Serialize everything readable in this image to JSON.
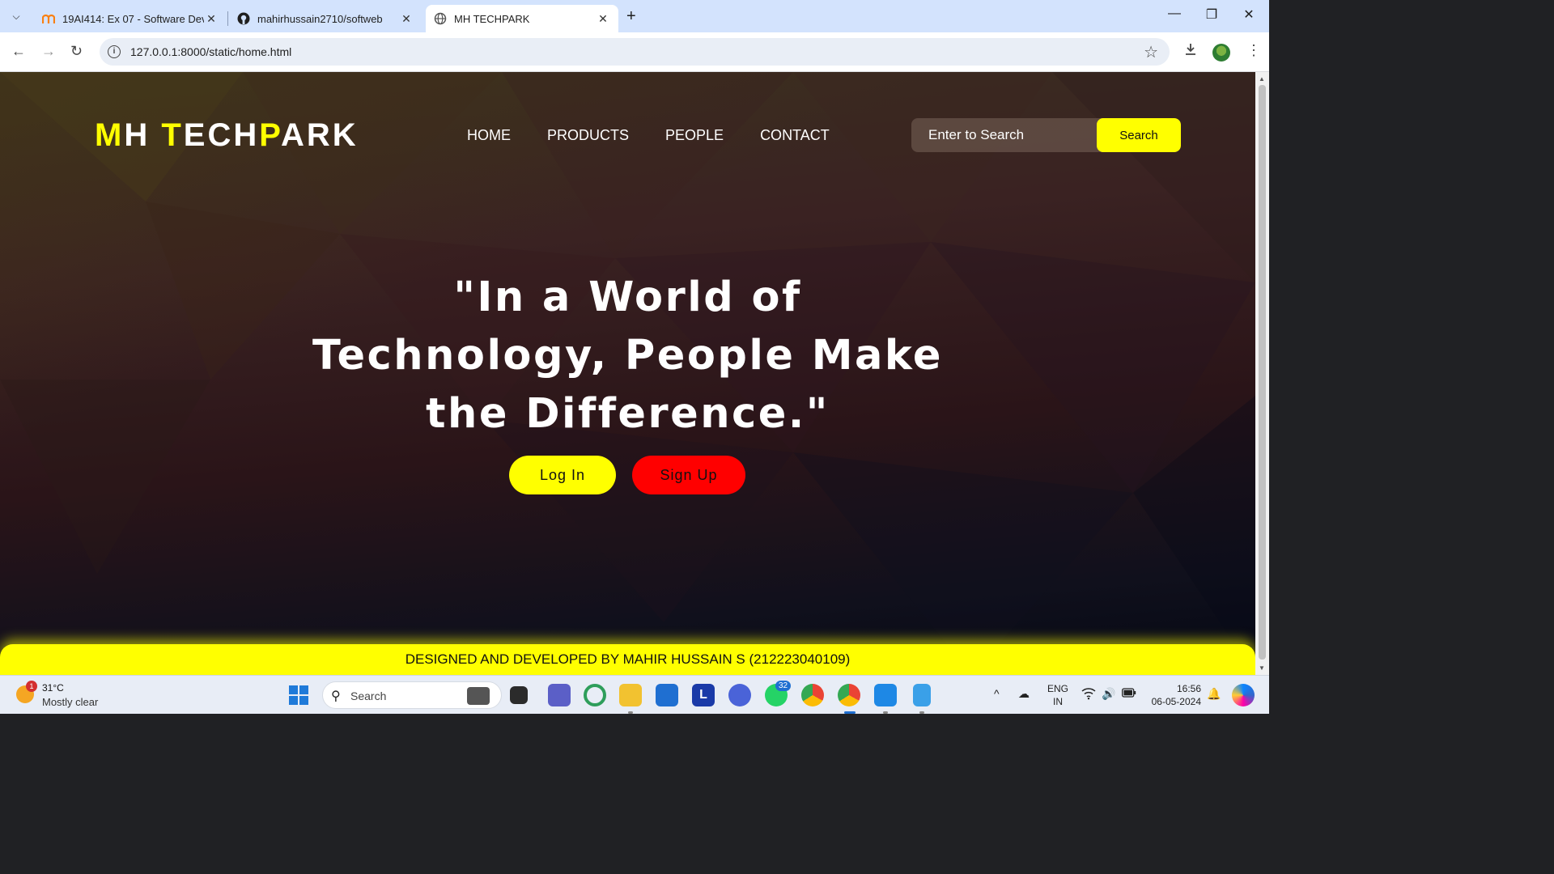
{
  "browser": {
    "tabs": [
      {
        "title": "19AI414: Ex 07 - Software Deve",
        "favicon": "moodle-icon"
      },
      {
        "title": "mahirhussain2710/softweb",
        "favicon": "github-icon"
      },
      {
        "title": "MH TECHPARK",
        "favicon": "globe-icon",
        "active": true
      }
    ],
    "url": "127.0.0.1:8000/static/home.html"
  },
  "site": {
    "logo": {
      "m": "M",
      "h": "H",
      "t": "T",
      "ech": "ECH",
      "p": "P",
      "ark": "ARK"
    },
    "nav": [
      "HOME",
      "PRODUCTS",
      "PEOPLE",
      "CONTACT"
    ],
    "search": {
      "placeholder": "Enter to Search",
      "button": "Search"
    },
    "hero": {
      "line1": "\"In a World of",
      "line2": "Technology, People Make",
      "line3": "the Difference.\""
    },
    "buttons": {
      "login": "Log In",
      "signup": "Sign Up"
    },
    "footer": "DESIGNED AND DEVELOPED BY MAHIR HUSSAIN S (212223040109)",
    "colors": {
      "accent": "#ffff00",
      "signup": "#ff0000"
    }
  },
  "taskbar": {
    "weather": {
      "temp": "31°C",
      "condition": "Mostly clear",
      "badge": "1"
    },
    "search_label": "Search",
    "whatsapp_badge": "32",
    "lang": {
      "line1": "ENG",
      "line2": "IN"
    },
    "time": "16:56",
    "date": "06-05-2024"
  }
}
